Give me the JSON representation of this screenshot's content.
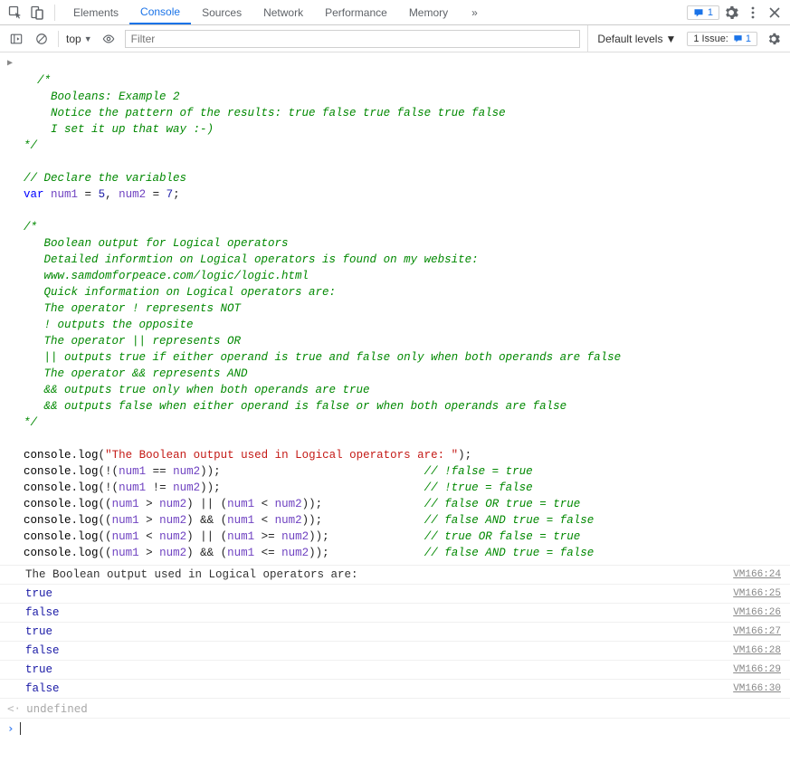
{
  "tabs": {
    "items": [
      "Elements",
      "Console",
      "Sources",
      "Network",
      "Performance",
      "Memory"
    ],
    "active_index": 1,
    "overflow_label": "»",
    "badge_count": "1"
  },
  "toolbar": {
    "context": "top",
    "filter_placeholder": "Filter",
    "levels_label": "Default levels",
    "issues_label": "1 Issue:",
    "issues_count": "1"
  },
  "code": {
    "lines": [
      {
        "t": "cm",
        "s": "/*"
      },
      {
        "t": "cm",
        "s": "    Booleans: Example 2"
      },
      {
        "t": "cm",
        "s": "    Notice the pattern of the results: true false true false true false"
      },
      {
        "t": "cm",
        "s": "    I set it up that way :-)"
      },
      {
        "t": "cm",
        "s": "*/"
      },
      {
        "t": "blank",
        "s": ""
      },
      {
        "t": "cm",
        "s": "// Declare the variables"
      },
      {
        "t": "decl",
        "kw": "var",
        "a": "num1",
        "av": "5",
        "b": "num2",
        "bv": "7"
      },
      {
        "t": "blank",
        "s": ""
      },
      {
        "t": "cm",
        "s": "/*"
      },
      {
        "t": "cm",
        "s": "   Boolean output for Logical operators"
      },
      {
        "t": "cm",
        "s": "   Detailed informtion on Logical operators is found on my website:"
      },
      {
        "t": "cm",
        "s": "   www.samdomforpeace.com/logic/logic.html"
      },
      {
        "t": "cm",
        "s": "   Quick information on Logical operators are:"
      },
      {
        "t": "cm",
        "s": "   The operator ! represents NOT"
      },
      {
        "t": "cm",
        "s": "   ! outputs the opposite"
      },
      {
        "t": "cm",
        "s": "   The operator || represents OR"
      },
      {
        "t": "cm",
        "s": "   || outputs true if either operand is true and false only when both operands are false"
      },
      {
        "t": "cm",
        "s": "   The operator && represents AND"
      },
      {
        "t": "cm",
        "s": "   && outputs true only when both operands are true"
      },
      {
        "t": "cm",
        "s": "   && outputs false when either operand is false or when both operands are false"
      },
      {
        "t": "cm",
        "s": "*/"
      },
      {
        "t": "blank",
        "s": ""
      },
      {
        "t": "logstr",
        "str": "\"The Boolean output used in Logical operators are: \""
      },
      {
        "t": "logexpr",
        "expr": "!(num1 == num2)",
        "pad": 30,
        "cmt": "// !false = true"
      },
      {
        "t": "logexpr",
        "expr": "!(num1 != num2)",
        "pad": 30,
        "cmt": "// !true = false"
      },
      {
        "t": "logexpr",
        "expr": "(num1 > num2) || (num1 < num2)",
        "pad": 15,
        "cmt": "// false OR true = true"
      },
      {
        "t": "logexpr",
        "expr": "(num1 > num2) && (num1 < num2)",
        "pad": 15,
        "cmt": "// false AND true = false"
      },
      {
        "t": "logexpr",
        "expr": "(num1 < num2) || (num1 >= num2)",
        "pad": 14,
        "cmt": "// true OR false = true"
      },
      {
        "t": "logexpr",
        "expr": "(num1 > num2) && (num1 <= num2)",
        "pad": 14,
        "cmt": "// false AND true = false"
      }
    ]
  },
  "output": {
    "rows": [
      {
        "text": "The Boolean output used in Logical operators are: ",
        "blue": false,
        "src": "VM166:24"
      },
      {
        "text": "true",
        "blue": true,
        "src": "VM166:25"
      },
      {
        "text": "false",
        "blue": true,
        "src": "VM166:26"
      },
      {
        "text": "true",
        "blue": true,
        "src": "VM166:27"
      },
      {
        "text": "false",
        "blue": true,
        "src": "VM166:28"
      },
      {
        "text": "true",
        "blue": true,
        "src": "VM166:29"
      },
      {
        "text": "false",
        "blue": true,
        "src": "VM166:30"
      }
    ],
    "return_value": "undefined"
  }
}
